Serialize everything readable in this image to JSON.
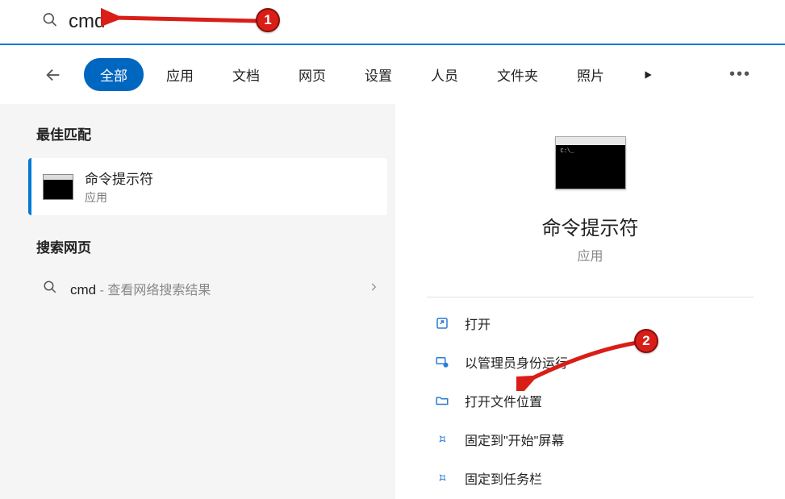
{
  "search": {
    "value": "cmd"
  },
  "tabs": {
    "back_icon": "back-icon",
    "items": [
      "全部",
      "应用",
      "文档",
      "网页",
      "设置",
      "人员",
      "文件夹",
      "照片"
    ],
    "active_index": 0
  },
  "left": {
    "best_match_header": "最佳匹配",
    "best_match": {
      "title": "命令提示符",
      "subtitle": "应用"
    },
    "web_header": "搜索网页",
    "web_item": {
      "query": "cmd",
      "separator": " - ",
      "desc": "查看网络搜索结果"
    }
  },
  "right": {
    "title": "命令提示符",
    "category": "应用",
    "actions": [
      {
        "icon": "open-external-icon",
        "label": "打开"
      },
      {
        "icon": "admin-run-icon",
        "label": "以管理员身份运行"
      },
      {
        "icon": "folder-icon",
        "label": "打开文件位置"
      },
      {
        "icon": "pin-icon",
        "label": "固定到\"开始\"屏幕"
      },
      {
        "icon": "pin-icon",
        "label": "固定到任务栏"
      }
    ]
  },
  "annotations": {
    "badge1": "1",
    "badge2": "2"
  }
}
